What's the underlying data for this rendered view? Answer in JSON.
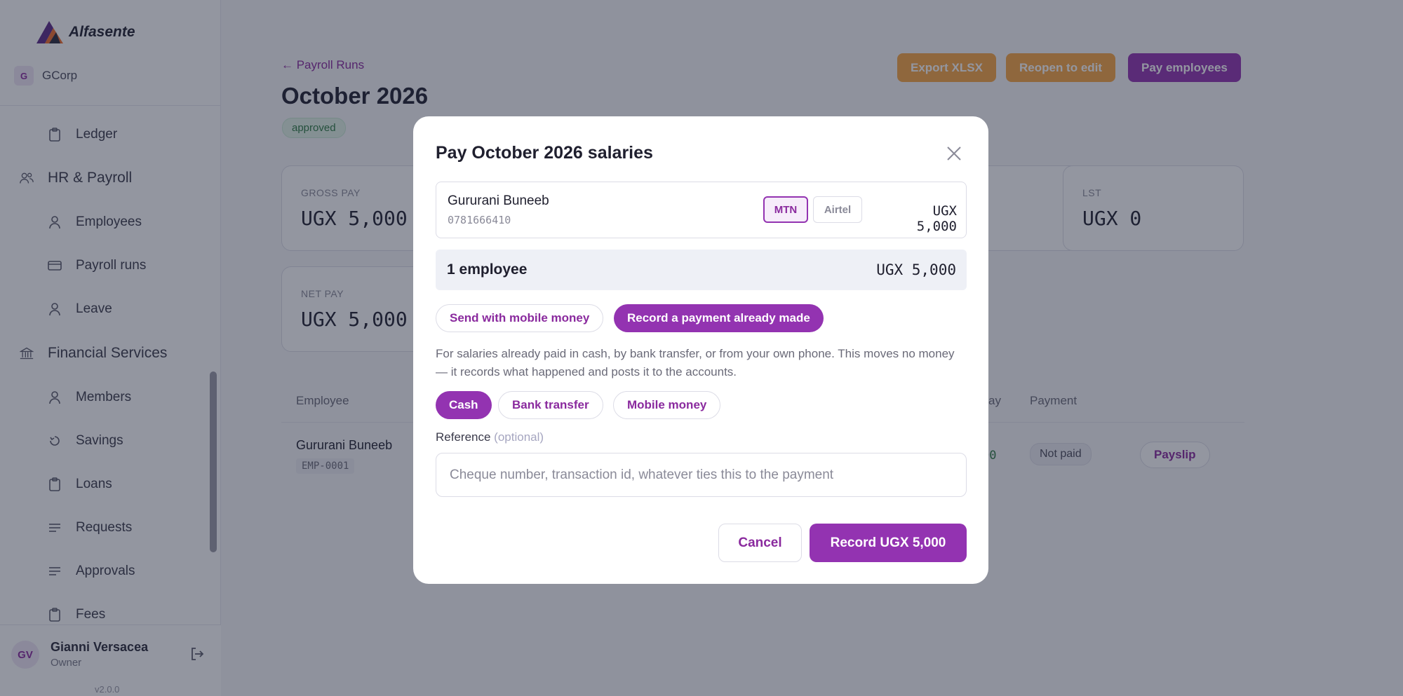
{
  "app": {
    "brand_name": "Alfasente",
    "org_initial": "G",
    "org_name": "GCorp",
    "version": "v2.0.0"
  },
  "sidebar": {
    "items": [
      {
        "label": "Ledger",
        "icon": "clipboard-icon"
      },
      {
        "label": "HR & Payroll",
        "icon": "people-icon",
        "group": true
      },
      {
        "label": "Employees",
        "icon": "person-icon"
      },
      {
        "label": "Payroll runs",
        "icon": "card-icon"
      },
      {
        "label": "Leave",
        "icon": "person-icon"
      },
      {
        "label": "Financial Services",
        "icon": "bank-icon",
        "group": true
      },
      {
        "label": "Members",
        "icon": "person-icon"
      },
      {
        "label": "Savings",
        "icon": "savings-icon"
      },
      {
        "label": "Loans",
        "icon": "clipboard-icon"
      },
      {
        "label": "Requests",
        "icon": "list-icon"
      },
      {
        "label": "Approvals",
        "icon": "list-icon"
      },
      {
        "label": "Fees",
        "icon": "clipboard-icon"
      }
    ]
  },
  "user": {
    "initials": "GV",
    "name": "Gianni Versacea",
    "role": "Owner"
  },
  "page": {
    "back_link": "← Payroll Runs",
    "title": "October 2026",
    "status": "approved",
    "actions": {
      "export": "Export XLSX",
      "reopen": "Reopen to edit",
      "pay": "Pay employees"
    },
    "stats": {
      "gross_label": "GROSS PAY",
      "gross_value": "UGX 5,000",
      "lst_label": "LST",
      "lst_value": "UGX 0",
      "net_label": "NET PAY",
      "net_value": "UGX 5,000"
    },
    "table": {
      "headers": {
        "employee": "Employee",
        "pay_partial": "ay",
        "payment": "Payment"
      },
      "rows": [
        {
          "name": "Gururani Buneeb",
          "code": "EMP-0001",
          "net_partial": "00",
          "payment_status": "Not paid",
          "action": "Payslip"
        }
      ]
    }
  },
  "modal": {
    "title": "Pay October 2026 salaries",
    "employee": {
      "name": "Gururani Buneeb",
      "phone": "0781666410",
      "network_selected": "MTN",
      "network_other": "Airtel",
      "amount": "UGX 5,000"
    },
    "total": {
      "label": "1 employee",
      "amount": "UGX 5,000"
    },
    "mode_send": "Send with mobile money",
    "mode_record": "Record a payment already made",
    "hint": "For salaries already paid in cash, by bank transfer, or from your own phone. This moves no money — it records what happened and posts it to the accounts.",
    "methods": {
      "cash": "Cash",
      "bank": "Bank transfer",
      "mobile": "Mobile money"
    },
    "reference_label": "Reference",
    "reference_optional": "(optional)",
    "reference_placeholder": "Cheque number, transaction id, whatever ties this to the payment",
    "reference_value": "",
    "cancel": "Cancel",
    "record": "Record UGX 5,000"
  },
  "colors": {
    "accent": "#9333b1",
    "orange": "#f7a641",
    "approved": "#2c7a42"
  }
}
